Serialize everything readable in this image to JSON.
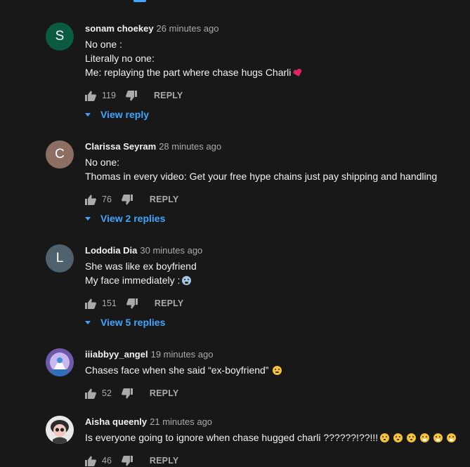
{
  "comments": [
    {
      "avatar_letter": "S",
      "avatar_color": "#0b5b43",
      "author": "sonam choekey",
      "time": "26 minutes ago",
      "lines": [
        "No one :",
        "Literally no one:",
        "Me: replaying the part where chase hugs Charli"
      ],
      "likes": "119",
      "reply_label": "REPLY",
      "view_replies": "View reply"
    },
    {
      "avatar_letter": "C",
      "avatar_color": "#8d6e63",
      "author": "Clarissa Seyram",
      "time": "28 minutes ago",
      "lines": [
        "No one:",
        "Thomas in every video: Get your free hype chains just pay shipping and handling"
      ],
      "likes": "76",
      "reply_label": "REPLY",
      "view_replies": "View 2 replies"
    },
    {
      "avatar_letter": "L",
      "avatar_color": "#4f616c",
      "author": "Lododia Dia",
      "time": "30 minutes ago",
      "lines": [
        "She was like ex boyfriend",
        "My face immediately :"
      ],
      "likes": "151",
      "reply_label": "REPLY",
      "view_replies": "View 5 replies"
    },
    {
      "avatar_letter": "",
      "author": "iiiabbyy_angel",
      "time": "19 minutes ago",
      "lines": [
        "Chases face when she said “ex-boyfriend”"
      ],
      "likes": "52",
      "reply_label": "REPLY"
    },
    {
      "avatar_letter": "",
      "author": "Aisha queenly",
      "time": "21 minutes ago",
      "lines": [
        "Is everyone going to ignore when chase hugged charli ??????!??!!!"
      ],
      "likes": "46",
      "reply_label": "REPLY"
    }
  ],
  "icons": {
    "like": "thumb-up-icon",
    "dislike": "thumb-down-icon",
    "expand": "chevron-down-icon"
  },
  "colors": {
    "background": "#181818",
    "link": "#3ea6ff",
    "secondary_text": "#aaaaaa"
  }
}
